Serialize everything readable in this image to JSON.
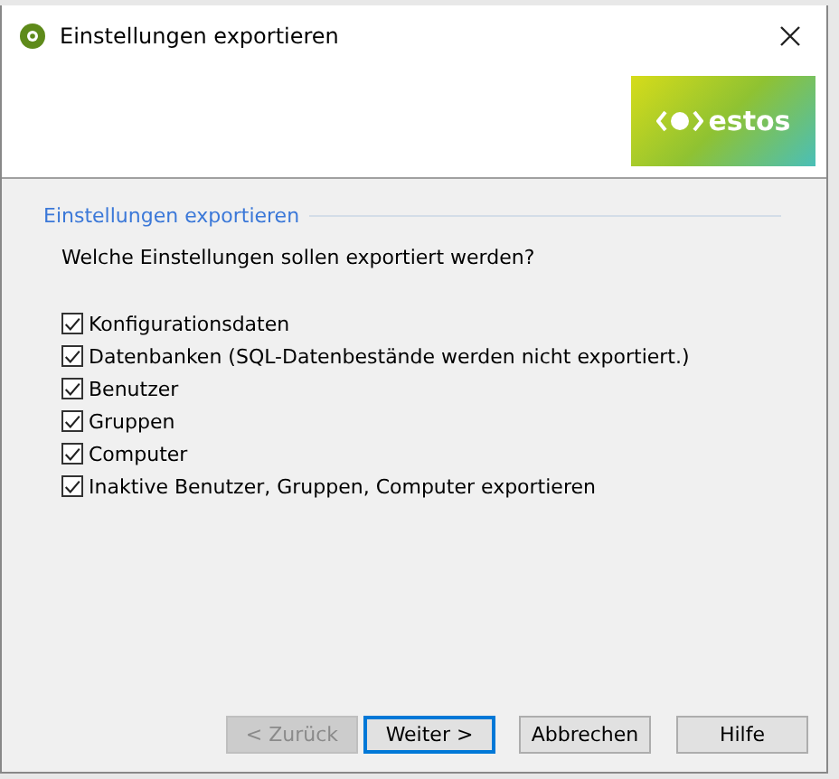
{
  "window": {
    "title": "Einstellungen exportieren"
  },
  "logo": {
    "text": "estos"
  },
  "group": {
    "title": "Einstellungen exportieren",
    "question": "Welche Einstellungen sollen exportiert werden?",
    "options": [
      {
        "label": "Konfigurationsdaten",
        "checked": true
      },
      {
        "label": "Datenbanken (SQL-Datenbestände werden nicht exportiert.)",
        "checked": true
      },
      {
        "label": "Benutzer",
        "checked": true
      },
      {
        "label": "Gruppen",
        "checked": true
      },
      {
        "label": "Computer",
        "checked": true
      },
      {
        "label": "Inaktive Benutzer, Gruppen, Computer exportieren",
        "checked": true
      }
    ]
  },
  "buttons": [
    {
      "label": "< Zurück",
      "disabled": true,
      "selected": false
    },
    {
      "label": "Weiter >",
      "disabled": false,
      "selected": true
    },
    {
      "label": "Abbrechen",
      "disabled": false,
      "selected": false
    },
    {
      "label": "Hilfe",
      "disabled": false,
      "selected": false
    }
  ]
}
